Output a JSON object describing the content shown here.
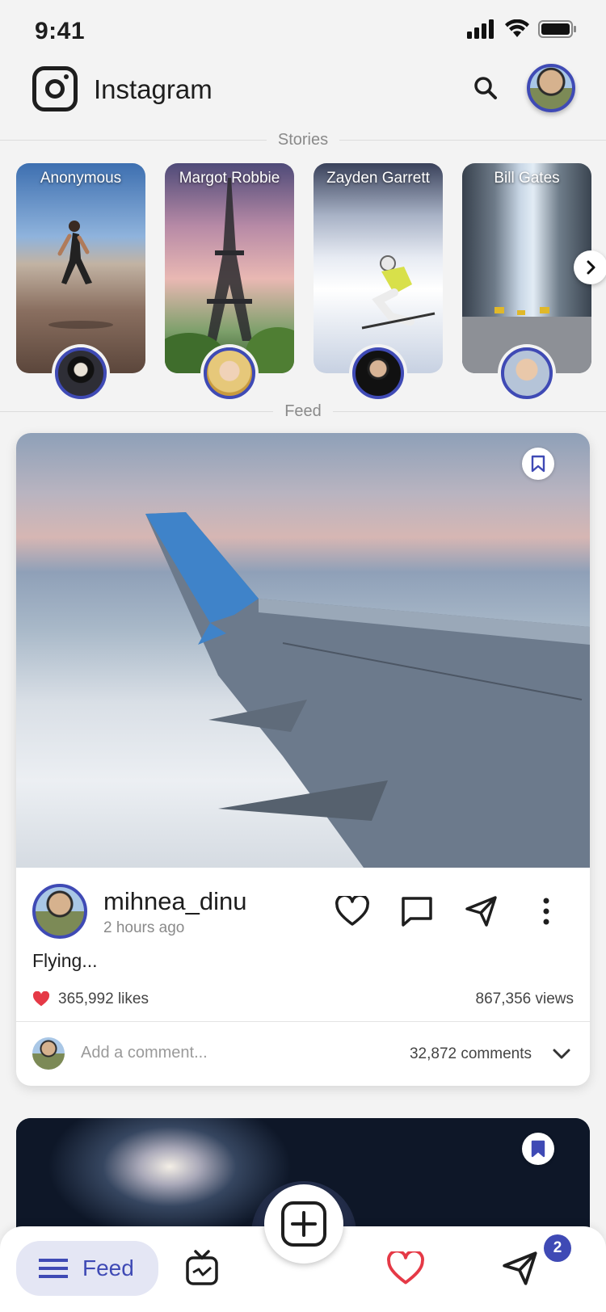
{
  "status_bar": {
    "time": "9:41"
  },
  "header": {
    "app_title": "Instagram"
  },
  "sections": {
    "stories": "Stories",
    "feed": "Feed"
  },
  "stories": [
    {
      "name": "Anonymous"
    },
    {
      "name": "Margot Robbie"
    },
    {
      "name": "Zayden Garrett"
    },
    {
      "name": "Bill Gates"
    }
  ],
  "post": {
    "username": "mihnea_dinu",
    "time": "2 hours ago",
    "caption": "Flying...",
    "likes": "365,992 likes",
    "views": "867,356 views",
    "comment_placeholder": "Add a comment...",
    "comments": "32,872 comments"
  },
  "nav": {
    "feed_label": "Feed",
    "messages_badge": "2"
  },
  "colors": {
    "accent": "#3f4ab5",
    "like_red": "#e53946",
    "background": "#f3f3f3"
  },
  "icons": [
    "instagram-logo-icon",
    "search-icon",
    "chevron-right-icon",
    "bookmark-icon",
    "heart-icon",
    "comment-icon",
    "send-icon",
    "more-vertical-icon",
    "chevron-down-icon",
    "menu-lines-icon",
    "tv-icon",
    "plus-square-icon"
  ]
}
